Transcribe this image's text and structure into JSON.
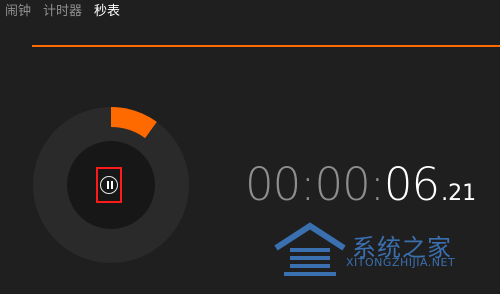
{
  "tabs": [
    {
      "label": "闹钟"
    },
    {
      "label": "计时器"
    },
    {
      "label": "秒表"
    }
  ],
  "active_tab": "秒表",
  "stopwatch": {
    "hours": "00",
    "sep1": ":",
    "minutes": "00",
    "sep2": ":",
    "seconds": "06",
    "fraction": ".21",
    "progress_fraction": 0.1
  },
  "watermark": {
    "brand": "系统之家",
    "url": "XITONGZHIJIA.NET"
  },
  "colors": {
    "background": "#1f1f1f",
    "accent": "#ff6a00",
    "dial_outer": "#2a2a2a",
    "dial_inner": "#171717",
    "highlight_box": "#ff1a1a"
  },
  "icons": {
    "play_pause": "pause-icon",
    "watermark_logo": "house-logo-icon"
  }
}
